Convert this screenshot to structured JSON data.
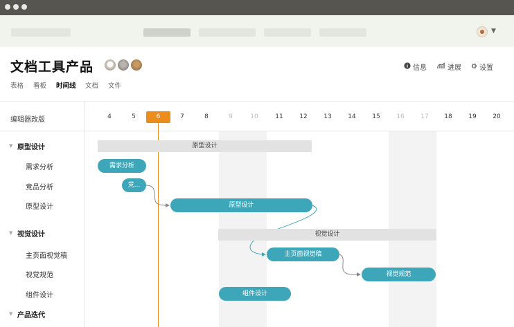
{
  "project": {
    "title": "文档工具产品",
    "actions": [
      {
        "icon": "info-icon",
        "label": "信息"
      },
      {
        "icon": "progress-chart-icon",
        "label": "进展"
      },
      {
        "icon": "gear-icon",
        "label": "设置"
      }
    ],
    "views": [
      "表格",
      "看板",
      "时间线",
      "文档",
      "文件"
    ],
    "active_view": "时间线"
  },
  "gantt": {
    "left_title": "编辑器改版",
    "days": [
      {
        "label": "4",
        "weekend": false
      },
      {
        "label": "5",
        "weekend": false
      },
      {
        "label": "6",
        "weekend": false,
        "today": true
      },
      {
        "label": "7",
        "weekend": false
      },
      {
        "label": "8",
        "weekend": false
      },
      {
        "label": "9",
        "weekend": true
      },
      {
        "label": "10",
        "weekend": true
      },
      {
        "label": "11",
        "weekend": false
      },
      {
        "label": "12",
        "weekend": false
      },
      {
        "label": "13",
        "weekend": false
      },
      {
        "label": "14",
        "weekend": false
      },
      {
        "label": "15",
        "weekend": false
      },
      {
        "label": "16",
        "weekend": true
      },
      {
        "label": "17",
        "weekend": true
      },
      {
        "label": "18",
        "weekend": false
      },
      {
        "label": "19",
        "weekend": false
      },
      {
        "label": "20",
        "weekend": false
      }
    ],
    "groups": [
      {
        "label": "原型设计",
        "tasks": [
          "需求分析",
          "竞品分析",
          "原型设计"
        ]
      },
      {
        "label": "视觉设计",
        "tasks": [
          "主页面视觉稿",
          "视觉规范",
          "组件设计"
        ]
      },
      {
        "label": "产品迭代",
        "tasks": []
      }
    ],
    "bars": {
      "group_proto": "原型设计",
      "req": "需求分析",
      "comp": "竞...",
      "proto": "原型设计",
      "group_visual": "视觉设计",
      "main_visual": "主页面视觉稿",
      "spec": "视觉规范",
      "component": "组件设计"
    }
  },
  "colors": {
    "accent_bar": "#3ea6b9",
    "today": "#ec8c1c",
    "group_bar": "#e2e2e2"
  }
}
